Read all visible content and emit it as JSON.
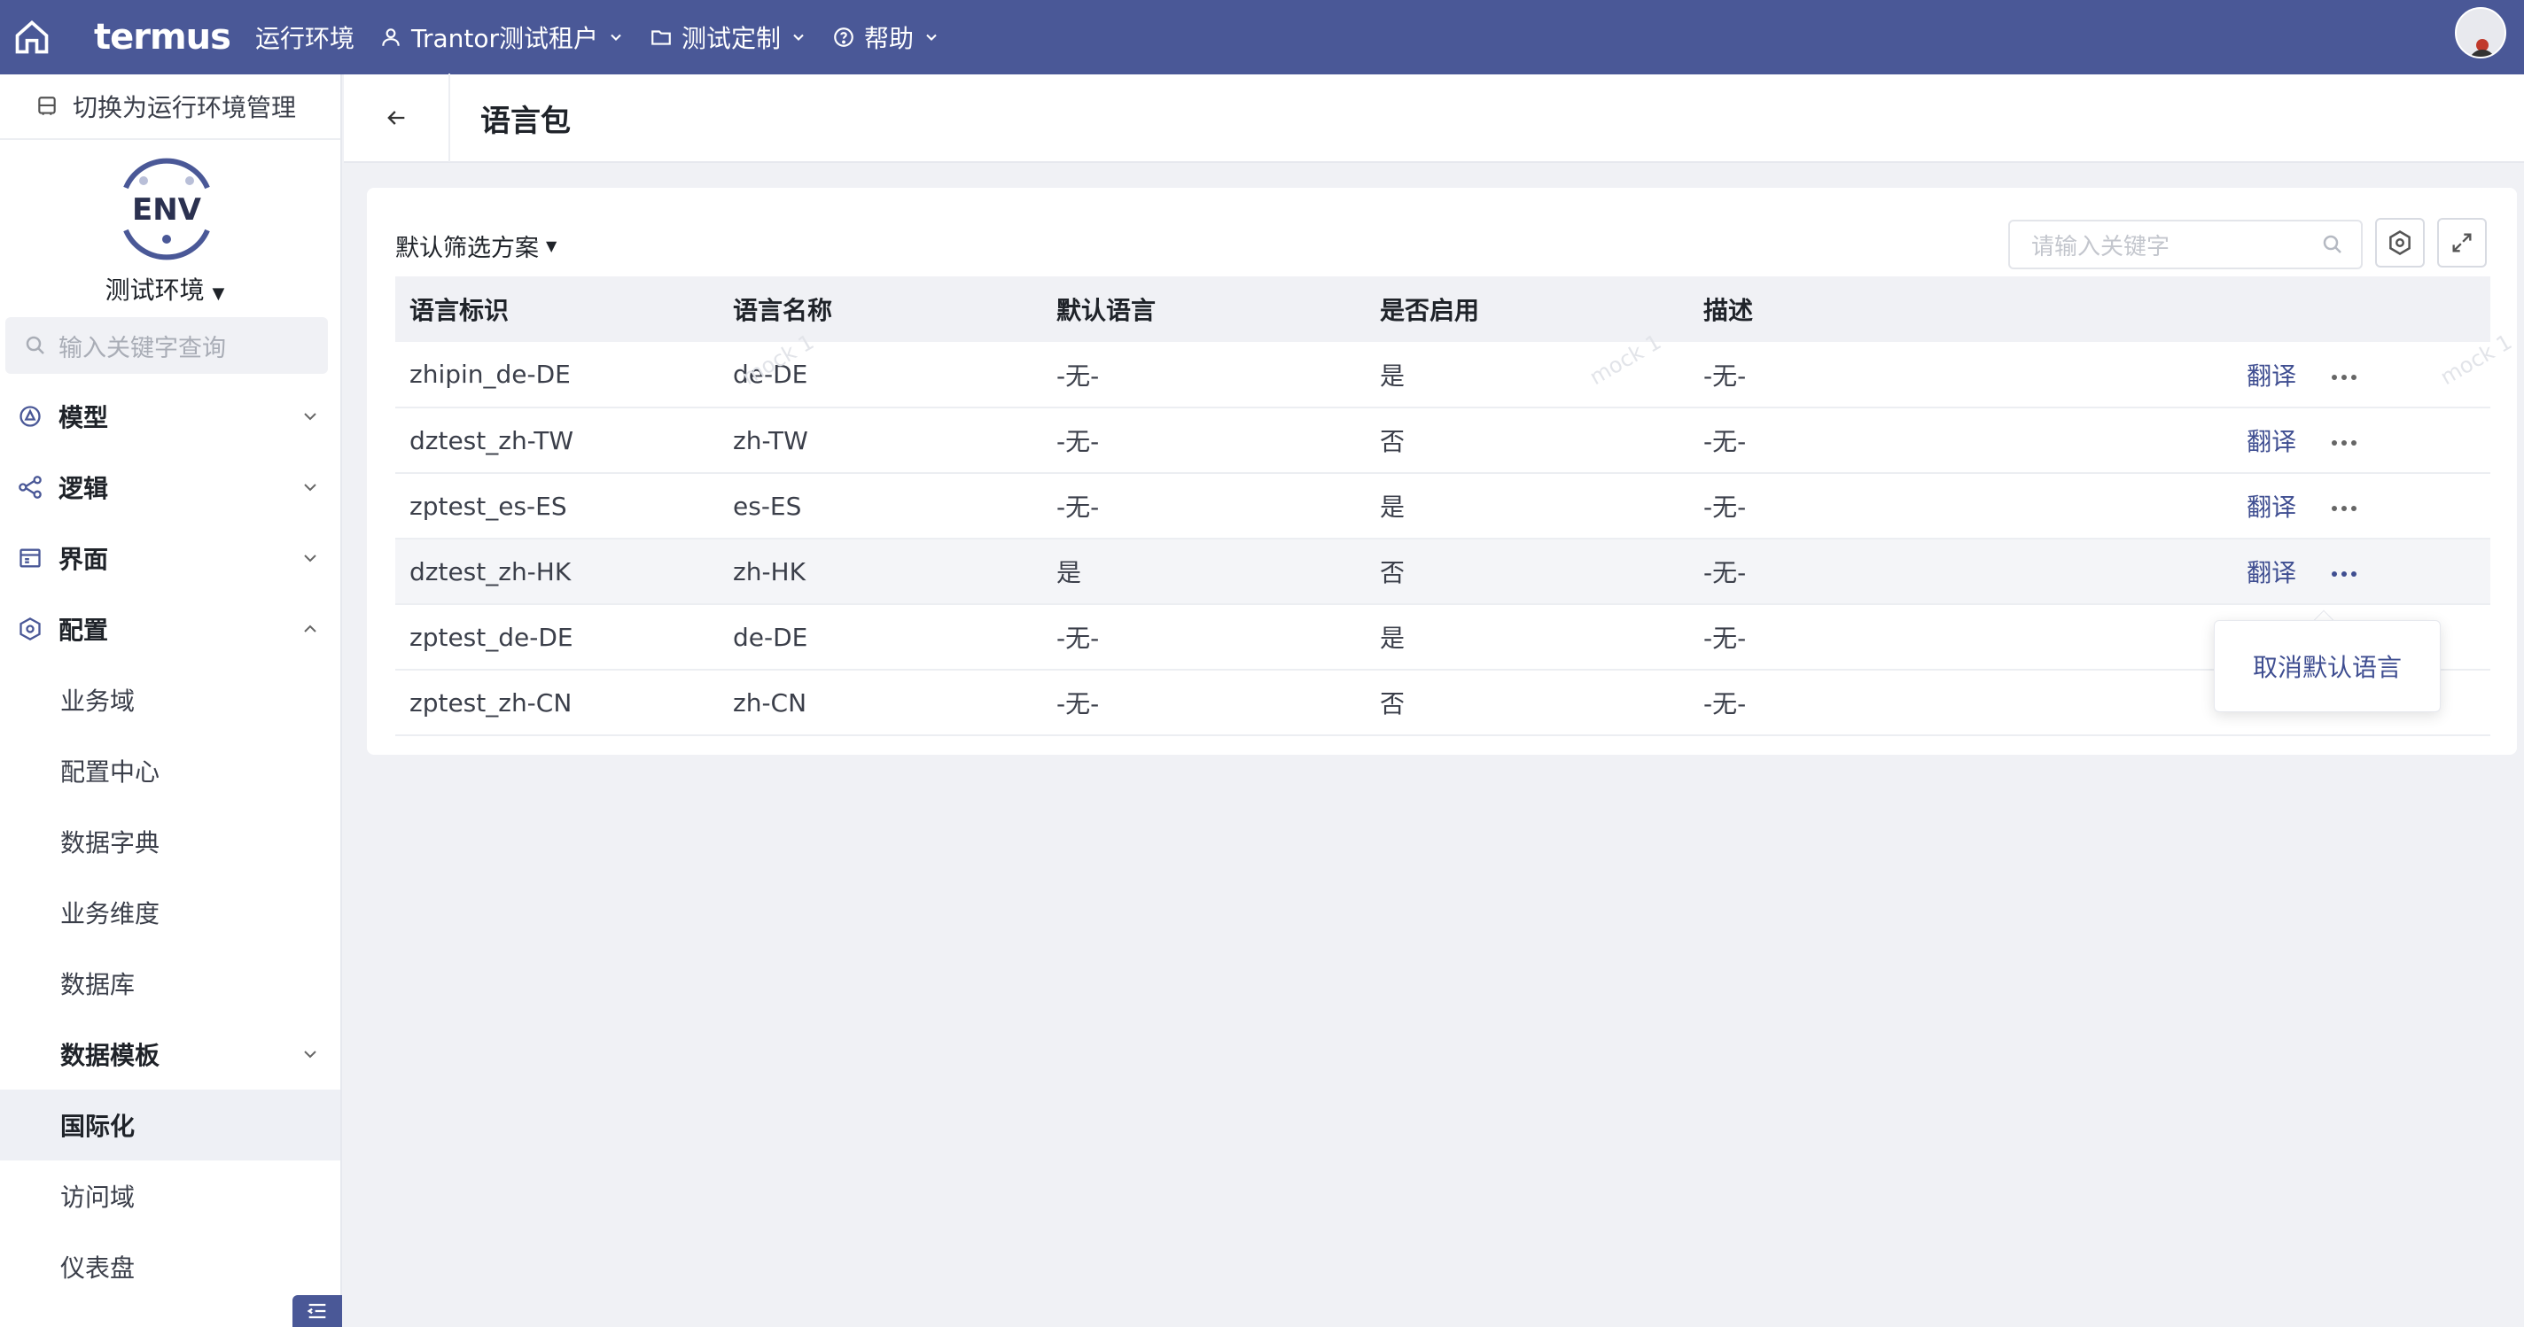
{
  "topbar": {
    "brand": "termus",
    "env_label": "运行环境",
    "tenant": "Trantor测试租户",
    "custom": "测试定制",
    "help": "帮助"
  },
  "sidebar": {
    "switch_label": "切换为运行环境管理",
    "logo_text": "ENV",
    "env_name": "测试环境",
    "search_placeholder": "输入关键字查询",
    "groups": [
      {
        "label": "模型",
        "icon": "model-icon"
      },
      {
        "label": "逻辑",
        "icon": "logic-icon"
      },
      {
        "label": "界面",
        "icon": "ui-icon"
      },
      {
        "label": "配置",
        "icon": "config-icon"
      }
    ],
    "config_items": [
      "业务域",
      "配置中心",
      "数据字典",
      "业务维度",
      "数据库",
      "数据模板",
      "国际化",
      "访问域",
      "仪表盘"
    ]
  },
  "page": {
    "title": "语言包",
    "filter_scheme": "默认筛选方案",
    "search_placeholder": "请输入关键字"
  },
  "table": {
    "headers": [
      "语言标识",
      "语言名称",
      "默认语言",
      "是否启用",
      "描述"
    ],
    "rows": [
      [
        "zhipin_de-DE",
        "de-DE",
        "-无-",
        "是",
        "-无-"
      ],
      [
        "dztest_zh-TW",
        "zh-TW",
        "-无-",
        "否",
        "-无-"
      ],
      [
        "zptest_es-ES",
        "es-ES",
        "-无-",
        "是",
        "-无-"
      ],
      [
        "dztest_zh-HK",
        "zh-HK",
        "是",
        "否",
        "-无-"
      ],
      [
        "zptest_de-DE",
        "de-DE",
        "-无-",
        "是",
        "-无-"
      ],
      [
        "zptest_zh-CN",
        "zh-CN",
        "-无-",
        "否",
        "-无-"
      ]
    ],
    "action_translate": "翻译"
  },
  "popup": {
    "label": "取消默认语言"
  },
  "watermark": "mock 1",
  "colors": {
    "topbar": "#4a5897",
    "link": "#3f4e91",
    "background": "#f0f1f5"
  }
}
